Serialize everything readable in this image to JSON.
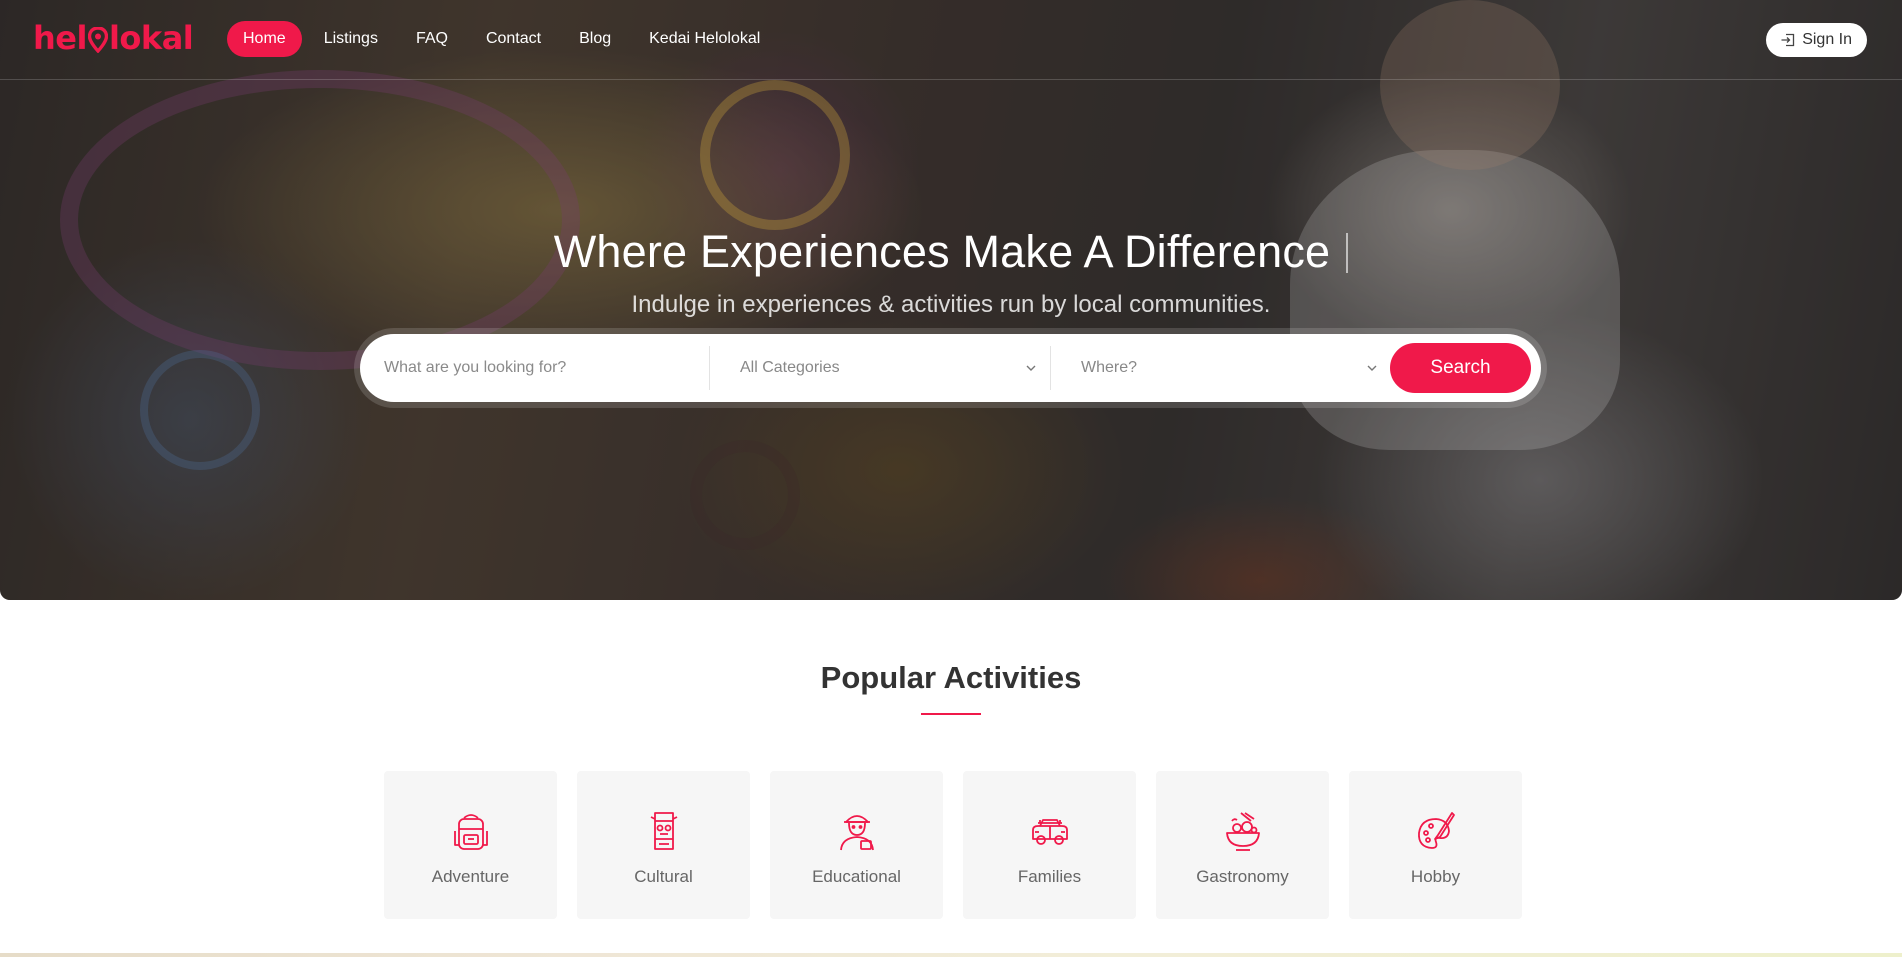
{
  "brand": {
    "logo_text_left": "hel",
    "logo_text_right": "lokal",
    "accent": "#f0194a"
  },
  "nav": {
    "items": [
      {
        "label": "Home",
        "active": true
      },
      {
        "label": "Listings",
        "active": false
      },
      {
        "label": "FAQ",
        "active": false
      },
      {
        "label": "Contact",
        "active": false
      },
      {
        "label": "Blog",
        "active": false
      },
      {
        "label": "Kedai Helolokal",
        "active": false
      }
    ],
    "signin_label": "Sign In",
    "signin_icon": "sign-in-icon"
  },
  "hero": {
    "title": "Where Experiences Make A Difference",
    "subtitle": "Indulge in experiences & activities run by local communities."
  },
  "search": {
    "query_placeholder": "What are you looking for?",
    "query_value": "",
    "category_value": "All Categories",
    "location_value": "Where?",
    "button_label": "Search"
  },
  "popular": {
    "title": "Popular Activities",
    "categories": [
      {
        "label": "Adventure",
        "icon": "backpack-icon"
      },
      {
        "label": "Cultural",
        "icon": "totem-mask-icon"
      },
      {
        "label": "Educational",
        "icon": "explorer-icon"
      },
      {
        "label": "Families",
        "icon": "car-icon"
      },
      {
        "label": "Gastronomy",
        "icon": "food-bowl-icon"
      },
      {
        "label": "Hobby",
        "icon": "paint-palette-icon"
      }
    ]
  }
}
